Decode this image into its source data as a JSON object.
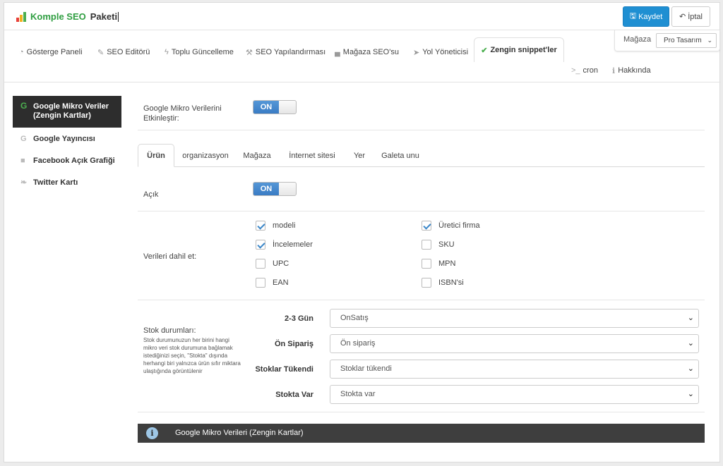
{
  "header": {
    "title_part1": "Komple SEO",
    "title_part2": "Paketi",
    "save_label": "Kaydet",
    "cancel_label": "İptal"
  },
  "store": {
    "label": "Mağaza",
    "selected": "Pro Tasarım"
  },
  "nav": {
    "tabs": [
      {
        "label": "Gösterge Paneli",
        "icon": "dashboard-icon"
      },
      {
        "label": "SEO Editörü",
        "icon": "edit-icon"
      },
      {
        "label": "Toplu Güncelleme",
        "icon": "bolt-icon"
      },
      {
        "label": "SEO Yapılandırması",
        "icon": "wrench-icon"
      },
      {
        "label": "Mağaza SEO'su",
        "icon": "chart-icon"
      },
      {
        "label": "Yol Yöneticisi",
        "icon": "location-arrow-icon"
      },
      {
        "label": "Zengin snippet'ler",
        "icon": "thumbs-up-icon",
        "active": true
      }
    ],
    "secondary": [
      {
        "label": "cron",
        "icon": "terminal-icon"
      },
      {
        "label": "Hakkında",
        "icon": "info-icon"
      }
    ]
  },
  "sidebar": {
    "items": [
      {
        "label": "Google Mikro Veriler (Zengin Kartlar)",
        "icon": "google-icon",
        "active": true
      },
      {
        "label": "Google Yayıncısı",
        "icon": "google-icon"
      },
      {
        "label": "Facebook Açık Grafiği",
        "icon": "facebook-icon"
      },
      {
        "label": "Twitter Kartı",
        "icon": "twitter-icon"
      }
    ]
  },
  "content": {
    "enable_label": "Google Mikro Verilerini Etkinleştir:",
    "enable_toggle": "ON",
    "tabs": [
      "Ürün",
      "organizasyon",
      "Mağaza",
      "İnternet sitesi",
      "Yer",
      "Galeta unu"
    ],
    "open_label": "Açık",
    "open_toggle": "ON",
    "include_label": "Verileri dahil et:",
    "checkboxes": [
      {
        "label": "modeli",
        "checked": true
      },
      {
        "label": "Üretici firma",
        "checked": true
      },
      {
        "label": "İncelemeler",
        "checked": true
      },
      {
        "label": "SKU",
        "checked": false
      },
      {
        "label": "UPC",
        "checked": false
      },
      {
        "label": "MPN",
        "checked": false
      },
      {
        "label": "EAN",
        "checked": false
      },
      {
        "label": "ISBN'si",
        "checked": false
      }
    ],
    "stock_label": "Stok durumları:",
    "stock_help": "Stok durumunuzun her birini hangi mikro veri stok durumuna bağlamak istediğinizi seçin, \"Stokta\" dışında herhangi biri yalnızca ürün sıfır miktara ulaştığında görüntülenir",
    "stock_rows": [
      {
        "label": "2-3 Gün",
        "value": "OnSatış"
      },
      {
        "label": "Ön Sipariş",
        "value": "Ön sipariş"
      },
      {
        "label": "Stoklar Tükendi",
        "value": "Stoklar tükendi"
      },
      {
        "label": "Stokta Var",
        "value": "Stokta var"
      }
    ],
    "info_bar": "Google Mikro Verileri (Zengin Kartlar)"
  },
  "colors": {
    "accent": "#1f8fd2",
    "brand_green": "#2f9e41",
    "toggle_on": "#3a7cc4",
    "dark": "#2d2d2d"
  }
}
